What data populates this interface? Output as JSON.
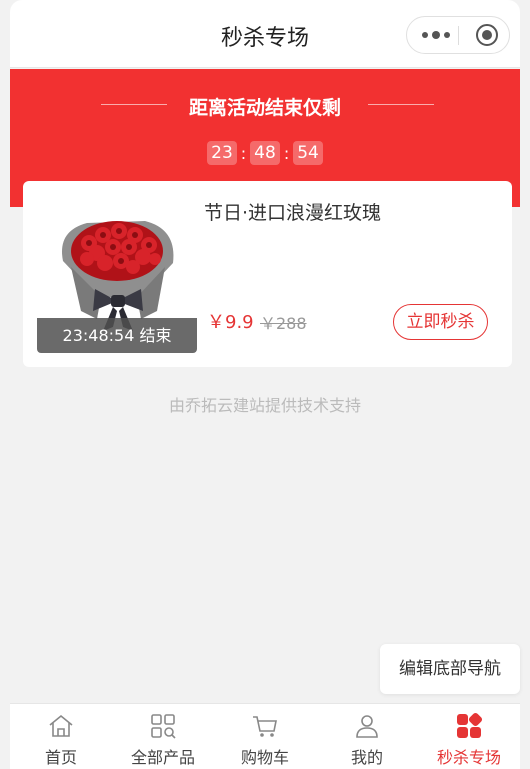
{
  "header": {
    "title": "秒杀专场"
  },
  "banner": {
    "heading": "距离活动结束仅剩",
    "countdown": {
      "hours": "23",
      "minutes": "48",
      "seconds": "54",
      "separator": ":"
    }
  },
  "product": {
    "name": "节日·进口浪漫红玫瑰",
    "timer_text": "23:48:54 结束",
    "price": "￥9.9",
    "original_price": "￥288",
    "buy_label": "立即秒杀"
  },
  "footer_note": "由乔拓云建站提供技术支持",
  "edit_nav_label": "编辑底部导航",
  "tabs": [
    {
      "label": "首页",
      "icon": "home-icon"
    },
    {
      "label": "全部产品",
      "icon": "grid-search-icon"
    },
    {
      "label": "购物车",
      "icon": "cart-icon"
    },
    {
      "label": "我的",
      "icon": "user-icon"
    },
    {
      "label": "秒杀专场",
      "icon": "flash-sale-icon",
      "active": true
    }
  ],
  "colors": {
    "accent": "#e53535",
    "banner": "#f23131",
    "background": "#f2f2f2"
  }
}
